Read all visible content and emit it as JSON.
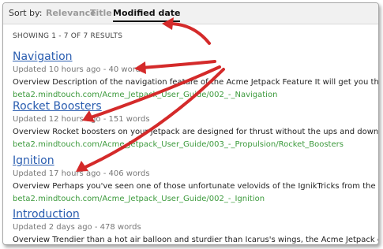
{
  "sort": {
    "label": "Sort by:",
    "options": [
      "Relevance",
      "Title",
      "Modified date"
    ],
    "active": "Modified date"
  },
  "results_count": "SHOWING 1 - 7 OF 7 RESULTS",
  "results": [
    {
      "title": "Navigation",
      "meta": "Updated 10 hours ago - 40 words",
      "snippet": "Overview Description of the navigation feature of the Acme Jetpack Feature It will get you there! What are",
      "url": "beta2.mindtouch.com/Acme_Jetpack_User_Guide/002_-_Navigation"
    },
    {
      "title": "Rocket Boosters",
      "meta": "Updated 12 hours ago - 151 words",
      "snippet": "Overview Rocket boosters on your Jetpack are designed for thrust without the ups and downs of other sys",
      "url": "beta2.mindtouch.com/Acme_Jetpack_User_Guide/003_-_Propulsion/Rocket_Boosters"
    },
    {
      "title": "Ignition",
      "meta": "Updated 17 hours ago - 406 words",
      "snippet": "Overview Perhaps you've seen one of those unfortunate velovids of the IgnikTricks from the '40's or the S",
      "url": "beta2.mindtouch.com/Acme_Jetpack_User_Guide/002_-_Ignition"
    },
    {
      "title": "Introduction",
      "meta": "Updated 2 days ago - 478 words",
      "snippet": "Overview Trendier than a hot air balloon and sturdier than Icarus's wings, the Acme Jetpack expands the",
      "url": ""
    }
  ],
  "colors": {
    "link": "#2a5db0",
    "url": "#3c9a3c",
    "arrow": "#d42a2a"
  },
  "annotation_icons": [
    "arrow-to-sort-icon",
    "arrow-to-meta-icon"
  ]
}
